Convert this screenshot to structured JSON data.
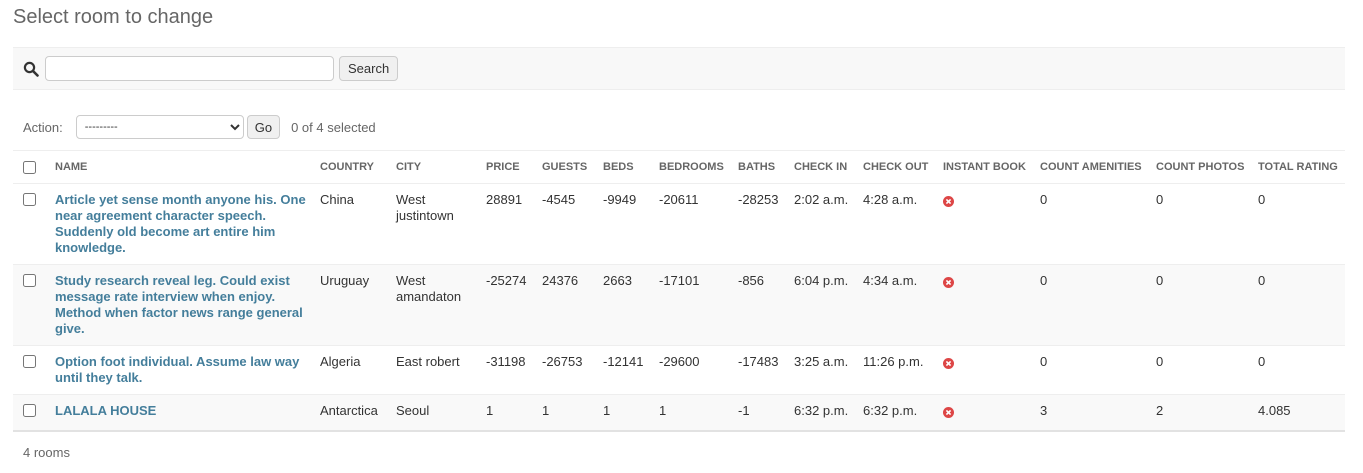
{
  "page": {
    "title": "Select room to change"
  },
  "search": {
    "value": "",
    "placeholder": "",
    "button_label": "Search"
  },
  "actions": {
    "label": "Action:",
    "selected_option": "---------",
    "go_label": "Go",
    "counter": "0 of 4 selected"
  },
  "table": {
    "columns": [
      "Name",
      "Country",
      "City",
      "Price",
      "Guests",
      "Beds",
      "Bedrooms",
      "Baths",
      "Check in",
      "Check out",
      "Instant book",
      "Count amenities",
      "Count photos",
      "Total rating"
    ],
    "rows": [
      {
        "name": "Article yet sense month anyone his. One near agreement character speech. Suddenly old become art entire him knowledge.",
        "country": "China",
        "city": "West justintown",
        "price": "28891",
        "guests": "-4545",
        "beds": "-9949",
        "bedrooms": "-20611",
        "baths": "-28253",
        "check_in": "2:02 a.m.",
        "check_out": "4:28 a.m.",
        "instant_book": "no",
        "count_amenities": "0",
        "count_photos": "0",
        "total_rating": "0"
      },
      {
        "name": "Study research reveal leg. Could exist message rate interview when enjoy. Method when factor news range general give.",
        "country": "Uruguay",
        "city": "West amandaton",
        "price": "-25274",
        "guests": "24376",
        "beds": "2663",
        "bedrooms": "-17101",
        "baths": "-856",
        "check_in": "6:04 p.m.",
        "check_out": "4:34 a.m.",
        "instant_book": "no",
        "count_amenities": "0",
        "count_photos": "0",
        "total_rating": "0"
      },
      {
        "name": "Option foot individual. Assume law way until they talk.",
        "country": "Algeria",
        "city": "East robert",
        "price": "-31198",
        "guests": "-26753",
        "beds": "-12141",
        "bedrooms": "-29600",
        "baths": "-17483",
        "check_in": "3:25 a.m.",
        "check_out": "11:26 p.m.",
        "instant_book": "no",
        "count_amenities": "0",
        "count_photos": "0",
        "total_rating": "0"
      },
      {
        "name": "LALALA HOUSE",
        "country": "Antarctica",
        "city": "Seoul",
        "price": "1",
        "guests": "1",
        "beds": "1",
        "bedrooms": "1",
        "baths": "-1",
        "check_in": "6:32 p.m.",
        "check_out": "6:32 p.m.",
        "instant_book": "no",
        "count_amenities": "3",
        "count_photos": "2",
        "total_rating": "4.085"
      }
    ]
  },
  "footer": {
    "count": "4 rooms"
  },
  "colors": {
    "link": "#447e9b",
    "no_icon": "#dd4646",
    "header_text": "#666666"
  },
  "icons": {
    "search": "search-icon",
    "instant_book_false": "icon-no"
  }
}
